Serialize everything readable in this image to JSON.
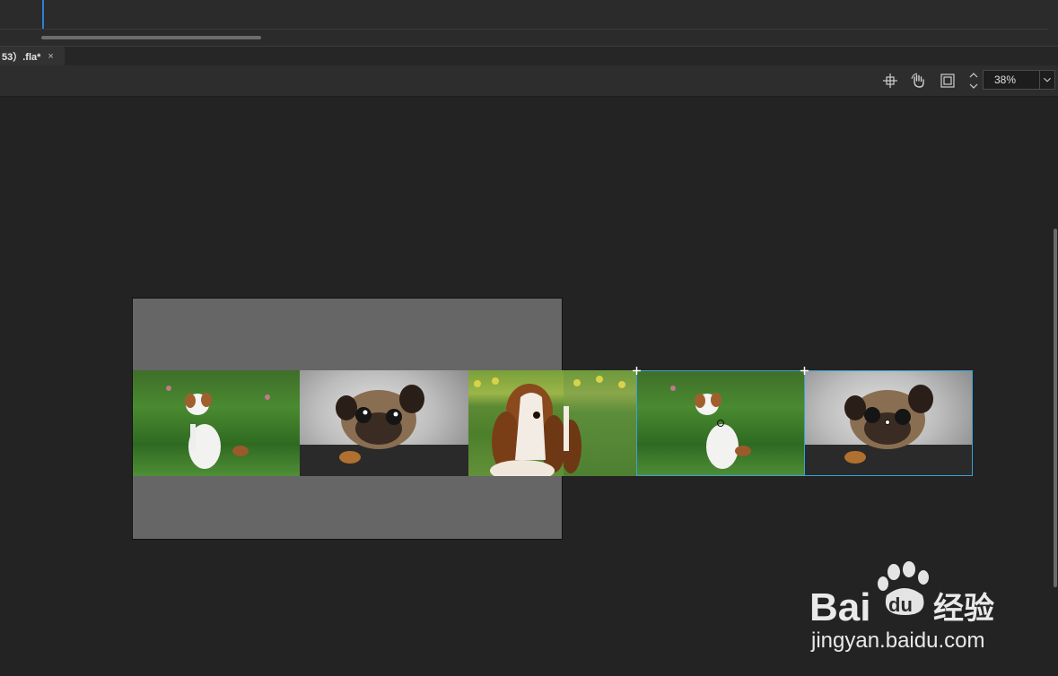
{
  "document_tab": {
    "label": "53）.fla*",
    "close_glyph": "×"
  },
  "toolbar": {
    "icons": [
      "snap-icon",
      "hand-rotate-icon",
      "fit-frame-icon",
      "chevron-up-icon",
      "chevron-down-icon"
    ],
    "zoom_value": "38%"
  },
  "stage": {
    "background_color": "#666666"
  },
  "selection": {
    "color": "#3aa0d8"
  },
  "watermark": {
    "brand": "Bai",
    "brand_mid": "du",
    "brand_cn": "经验",
    "url": "jingyan.baidu.com"
  }
}
